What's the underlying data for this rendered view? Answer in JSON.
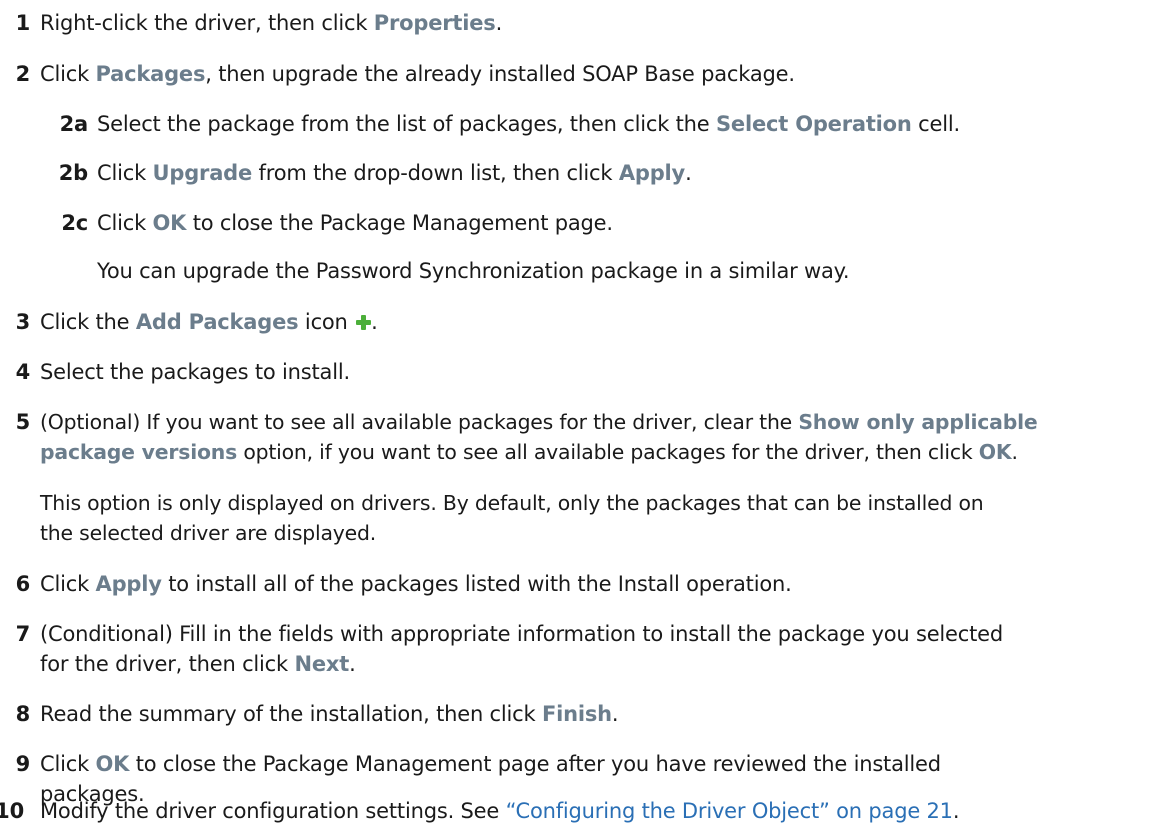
{
  "steps": [
    {
      "num": "1",
      "parts": [
        "Right-click the driver, then click ",
        "Properties",
        "."
      ]
    },
    {
      "num": "2",
      "parts": [
        "Click ",
        "Packages",
        ", then upgrade the already installed SOAP Base package."
      ]
    },
    {
      "num": "2a",
      "parts": [
        "Select the package from the list of packages, then click the ",
        "Select Operation",
        " cell."
      ]
    },
    {
      "num": "2b",
      "parts": [
        "Click ",
        "Upgrade",
        " from the drop-down list, then click ",
        "Apply",
        "."
      ]
    },
    {
      "num": "2c",
      "parts": [
        "Click ",
        "OK",
        " to close the Package Management page."
      ]
    },
    {
      "note_2c": "You can upgrade the Password Synchronization package in a similar way."
    },
    {
      "num": "3",
      "parts": [
        "Click the ",
        "Add Packages",
        " icon ",
        "."
      ]
    },
    {
      "num": "4",
      "parts": [
        "Select the packages to install."
      ]
    },
    {
      "num": "5",
      "line1": [
        "(Optional) If you want to see all available packages for the driver, clear the ",
        "Show only applicable"
      ],
      "line2": [
        "package versions",
        " option, if you want to see all available packages for the driver, then click ",
        "OK",
        "."
      ]
    },
    {
      "note_5_line1": "This option is only displayed on drivers. By default, only the packages that can be installed on",
      "note_5_line2": "the selected driver are displayed."
    },
    {
      "num": "6",
      "parts": [
        "Click ",
        "Apply",
        " to install all of the packages listed with the Install operation."
      ]
    },
    {
      "num": "7",
      "line1": [
        "(Conditional) Fill in the fields with appropriate information to install the package you selected"
      ],
      "line2": [
        "for the driver, then click ",
        "Next",
        "."
      ]
    },
    {
      "num": "8",
      "parts": [
        "Read the summary of the installation, then click ",
        "Finish",
        "."
      ]
    },
    {
      "num": "9",
      "line1": [
        "Click ",
        "OK",
        " to close the Package Management page after you have reviewed the installed"
      ],
      "line2": [
        "packages."
      ]
    },
    {
      "num": "10",
      "parts": [
        "Modify the driver configuration settings. See ",
        "“Configuring the Driver Object” on page 21",
        "."
      ]
    }
  ],
  "icons": {
    "add_packages": "plus-icon",
    "add_packages_color": "#4caf3a"
  },
  "colors": {
    "ui_label": "#6b7d8c",
    "link": "#2a6fb5"
  }
}
